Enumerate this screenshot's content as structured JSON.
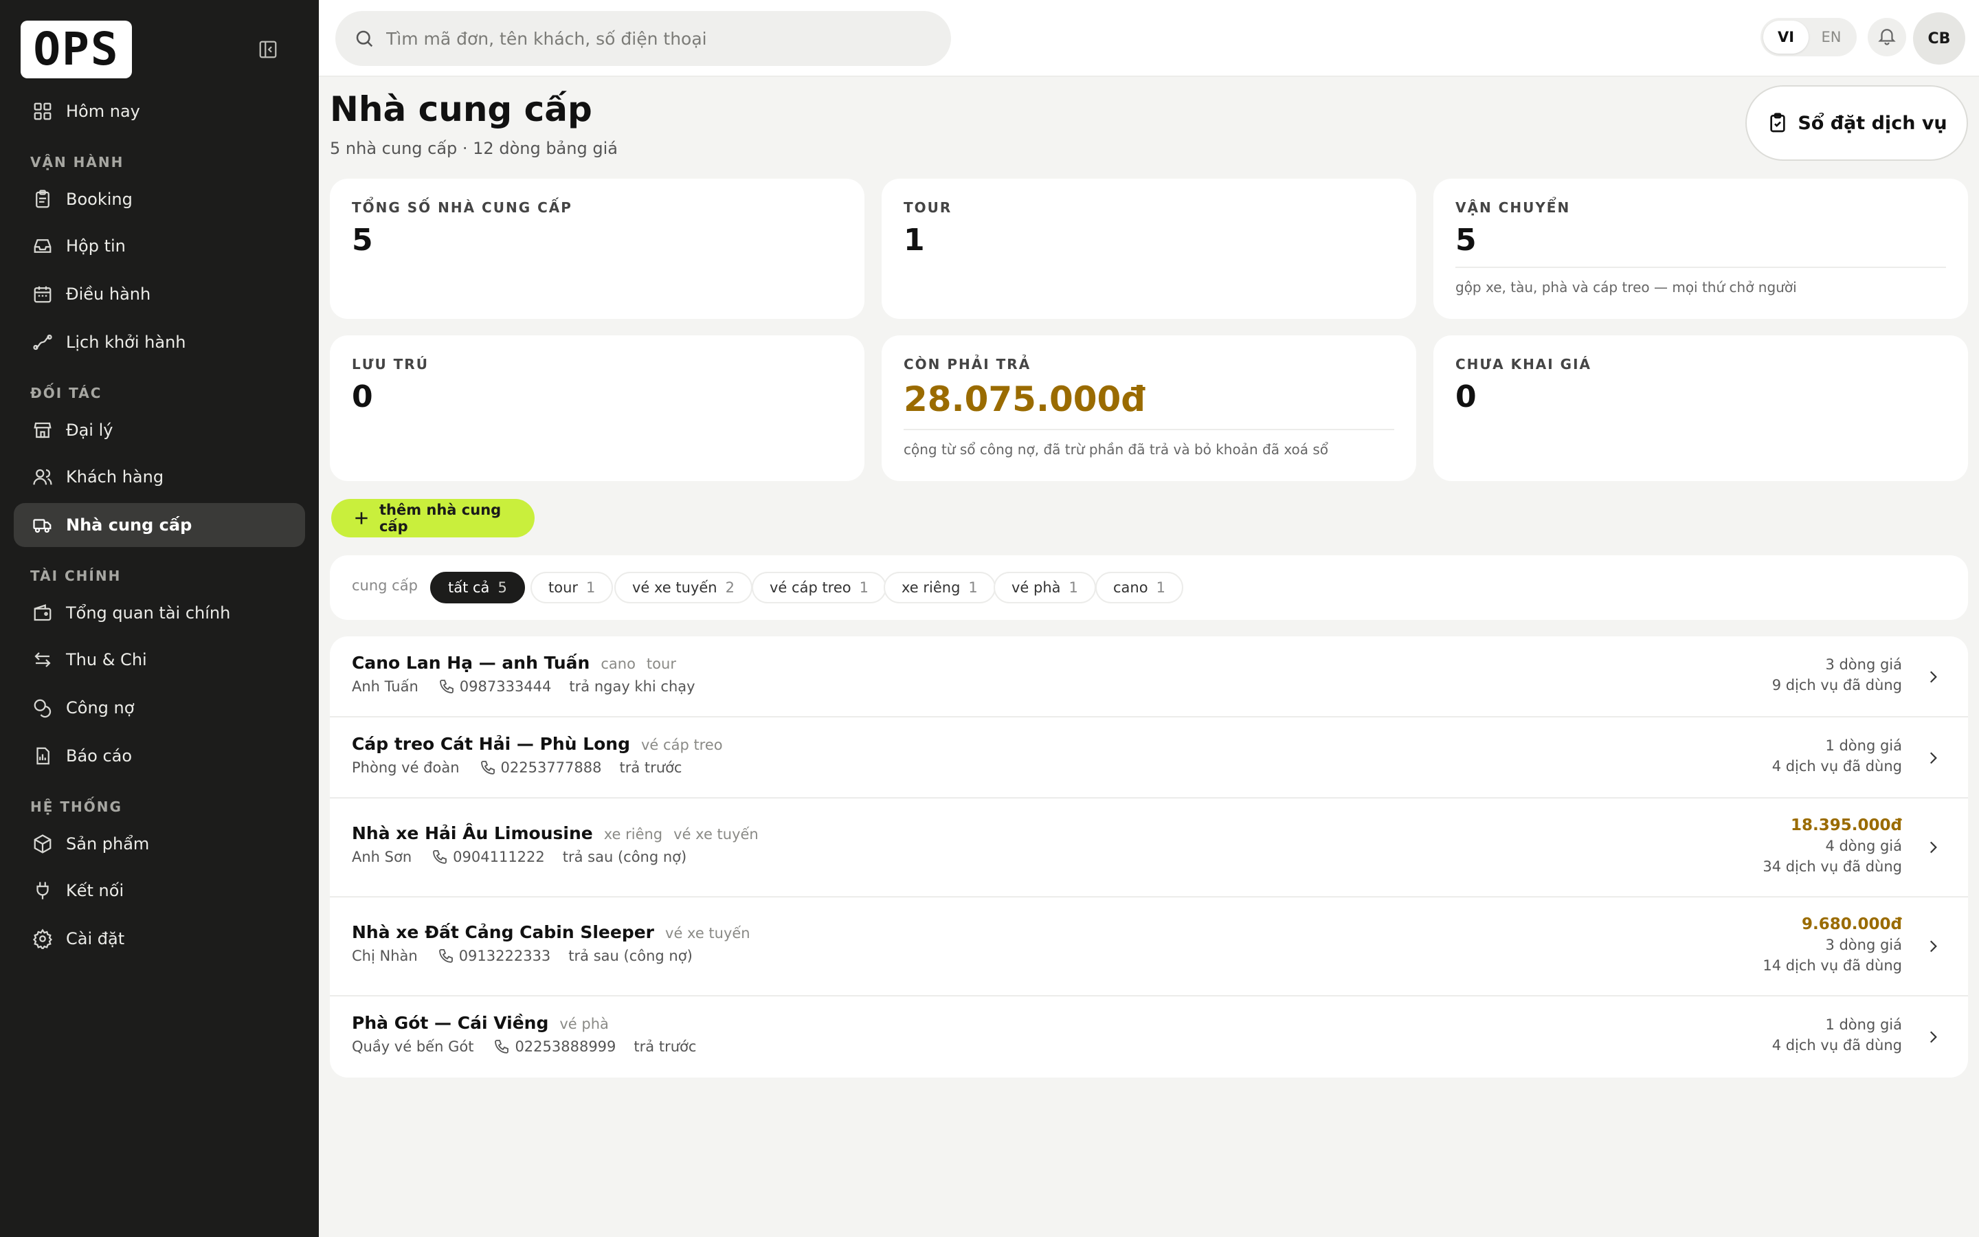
{
  "app": {
    "logo": "OPS"
  },
  "sidebar": {
    "today": "Hôm nay",
    "sections": {
      "operations": "VẬN HÀNH",
      "partners": "ĐỐI TÁC",
      "finance": "TÀI CHÍNH",
      "system": "HỆ THỐNG"
    },
    "items": {
      "booking": "Booking",
      "inbox": "Hộp tin",
      "dispatch": "Điều hành",
      "departures": "Lịch khởi hành",
      "agents": "Đại lý",
      "customers": "Khách hàng",
      "suppliers": "Nhà cung cấp",
      "finance_overview": "Tổng quan tài chính",
      "income_expense": "Thu & Chi",
      "debts": "Công nợ",
      "reports": "Báo cáo",
      "products": "Sản phẩm",
      "integrations": "Kết nối",
      "settings": "Cài đặt"
    }
  },
  "topbar": {
    "search_placeholder": "Tìm mã đơn, tên khách, số điện thoại",
    "lang_vi": "VI",
    "lang_en": "EN",
    "avatar": "CB"
  },
  "page": {
    "title": "Nhà cung cấp",
    "subtitle": "5 nhà cung cấp · 12 dòng bảng giá",
    "book_button": "Sổ đặt dịch vụ"
  },
  "stats": {
    "total": {
      "label": "TỔNG SỐ NHÀ CUNG CẤP",
      "value": "5"
    },
    "tour": {
      "label": "TOUR",
      "value": "1"
    },
    "transport": {
      "label": "VẬN CHUYỂN",
      "value": "5",
      "note": "gộp xe, tàu, phà và cáp treo — mọi thứ chở người"
    },
    "lodging": {
      "label": "LƯU TRÚ",
      "value": "0"
    },
    "payable": {
      "label": "CÒN PHẢI TRẢ",
      "value": "28.075.000đ",
      "note": "cộng từ sổ công nợ, đã trừ phần đã trả và bỏ khoản đã xoá sổ"
    },
    "unpriced": {
      "label": "CHƯA KHAI GIÁ",
      "value": "0"
    }
  },
  "add_button": "thêm nhà cung cấp",
  "filters": {
    "prefix": "cung cấp",
    "chips": [
      {
        "label": "tất cả",
        "count": "5"
      },
      {
        "label": "tour",
        "count": "1"
      },
      {
        "label": "vé xe tuyến",
        "count": "2"
      },
      {
        "label": "vé cáp treo",
        "count": "1"
      },
      {
        "label": "xe riêng",
        "count": "1"
      },
      {
        "label": "vé phà",
        "count": "1"
      },
      {
        "label": "cano",
        "count": "1"
      }
    ]
  },
  "suppliers": [
    {
      "name": "Cano Lan Hạ — anh Tuấn",
      "tag1": "cano",
      "tag2": "tour",
      "contact": "Anh Tuấn",
      "phone": "0987333444",
      "payment": "trả ngay khi chạy",
      "amount": "",
      "price_lines": "3 dòng giá",
      "services": "9 dịch vụ đã dùng"
    },
    {
      "name": "Cáp treo Cát Hải — Phù Long",
      "tag1": "vé cáp treo",
      "tag2": "",
      "contact": "Phòng vé đoàn",
      "phone": "02253777888",
      "payment": "trả trước",
      "amount": "",
      "price_lines": "1 dòng giá",
      "services": "4 dịch vụ đã dùng"
    },
    {
      "name": "Nhà xe Hải Âu Limousine",
      "tag1": "xe riêng",
      "tag2": "vé xe tuyến",
      "contact": "Anh Sơn",
      "phone": "0904111222",
      "payment": "trả sau (công nợ)",
      "amount": "18.395.000đ",
      "price_lines": "4 dòng giá",
      "services": "34 dịch vụ đã dùng"
    },
    {
      "name": "Nhà xe Đất Cảng Cabin Sleeper",
      "tag1": "vé xe tuyến",
      "tag2": "",
      "contact": "Chị Nhàn",
      "phone": "0913222333",
      "payment": "trả sau (công nợ)",
      "amount": "9.680.000đ",
      "price_lines": "3 dòng giá",
      "services": "14 dịch vụ đã dùng"
    },
    {
      "name": "Phà Gót — Cái Viềng",
      "tag1": "vé phà",
      "tag2": "",
      "contact": "Quầy vé bến Gót",
      "phone": "02253888999",
      "payment": "trả trước",
      "amount": "",
      "price_lines": "1 dòng giá",
      "services": "4 dịch vụ đã dùng"
    }
  ]
}
